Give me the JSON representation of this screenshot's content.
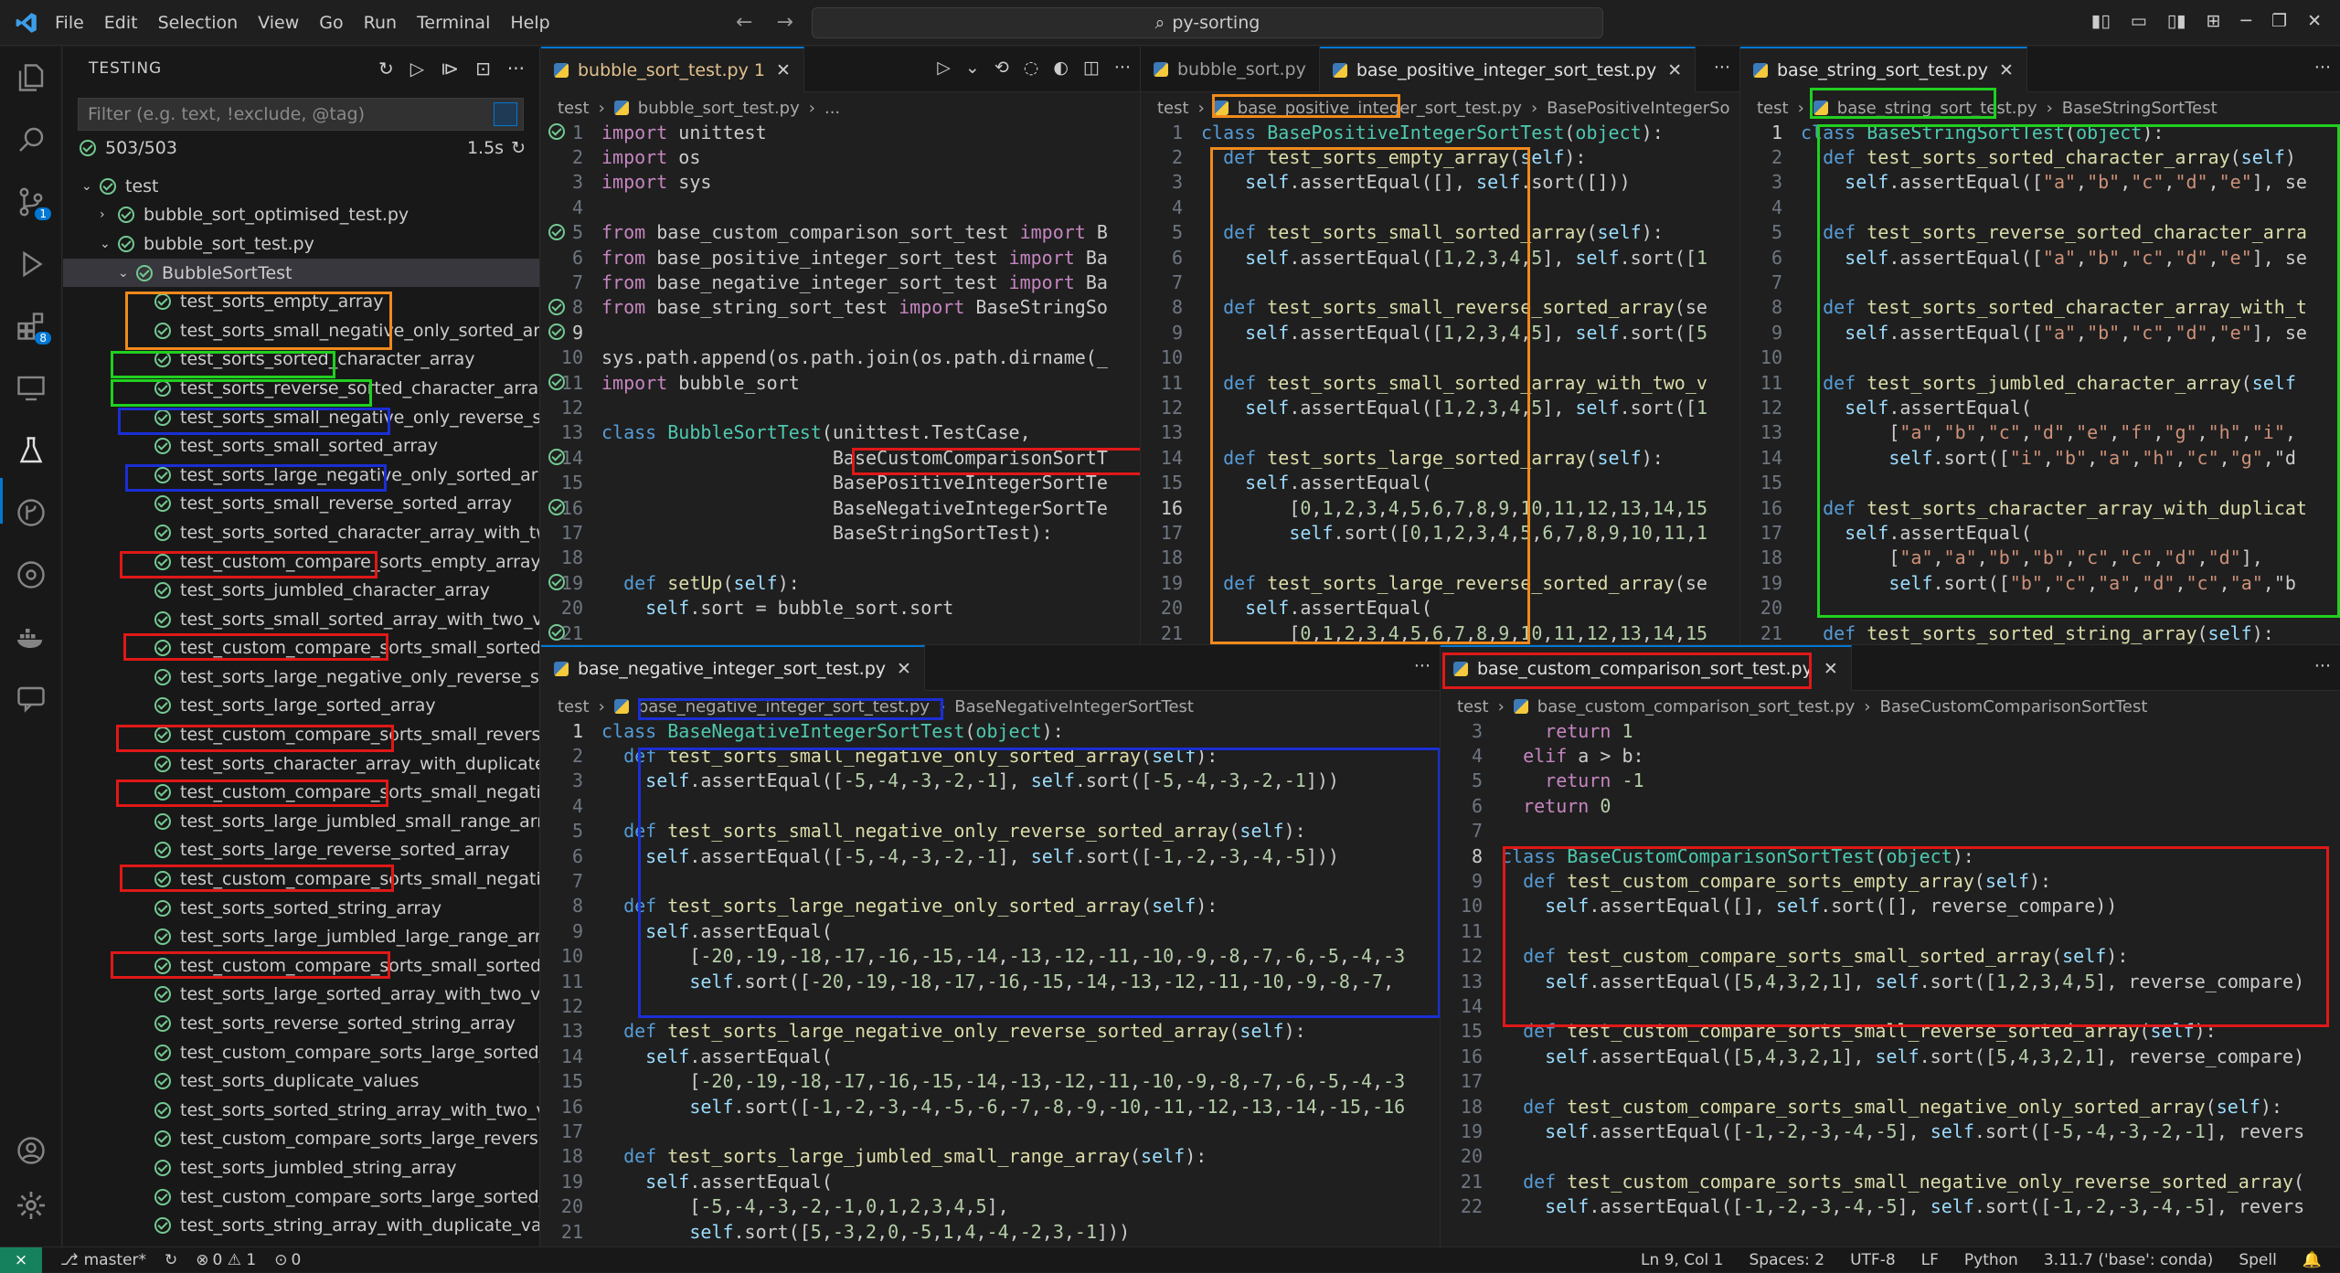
{
  "menu": [
    "File",
    "Edit",
    "Selection",
    "View",
    "Go",
    "Run",
    "Terminal",
    "Help"
  ],
  "command_center": "py-sorting",
  "sidebar": {
    "title": "TESTING",
    "filter_placeholder": "Filter (e.g. text, !exclude, @tag)",
    "summary": "503/503",
    "duration": "1.5s",
    "tree": [
      {
        "label": "test",
        "indent": 0,
        "chev": "v"
      },
      {
        "label": "bubble_sort_optimised_test.py",
        "indent": 1,
        "chev": ">"
      },
      {
        "label": "bubble_sort_test.py",
        "indent": 1,
        "chev": "v"
      },
      {
        "label": "BubbleSortTest",
        "indent": 2,
        "chev": "v"
      },
      {
        "label": "test_sorts_empty_array",
        "indent": 3
      },
      {
        "label": "test_sorts_small_negative_only_sorted_array",
        "indent": 3
      },
      {
        "label": "test_sorts_sorted_character_array",
        "indent": 3
      },
      {
        "label": "test_sorts_reverse_sorted_character_array",
        "indent": 3
      },
      {
        "label": "test_sorts_small_negative_only_reverse_sorte...",
        "indent": 3
      },
      {
        "label": "test_sorts_small_sorted_array",
        "indent": 3
      },
      {
        "label": "test_sorts_large_negative_only_sorted_array",
        "indent": 3
      },
      {
        "label": "test_sorts_small_reverse_sorted_array",
        "indent": 3
      },
      {
        "label": "test_sorts_sorted_character_array_with_two_v...",
        "indent": 3
      },
      {
        "label": "test_custom_compare_sorts_empty_array",
        "indent": 3
      },
      {
        "label": "test_sorts_jumbled_character_array",
        "indent": 3
      },
      {
        "label": "test_sorts_small_sorted_array_with_two_valu...",
        "indent": 3
      },
      {
        "label": "test_custom_compare_sorts_small_sorted_arr...",
        "indent": 3
      },
      {
        "label": "test_sorts_large_negative_only_reverse_sorte...",
        "indent": 3
      },
      {
        "label": "test_sorts_large_sorted_array",
        "indent": 3
      },
      {
        "label": "test_custom_compare_sorts_small_reverse_so...",
        "indent": 3
      },
      {
        "label": "test_sorts_character_array_with_duplicate_val...",
        "indent": 3
      },
      {
        "label": "test_custom_compare_sorts_small_negative_...",
        "indent": 3
      },
      {
        "label": "test_sorts_large_jumbled_small_range_array",
        "indent": 3
      },
      {
        "label": "test_sorts_large_reverse_sorted_array",
        "indent": 3
      },
      {
        "label": "test_custom_compare_sorts_small_negative_...",
        "indent": 3
      },
      {
        "label": "test_sorts_sorted_string_array",
        "indent": 3
      },
      {
        "label": "test_sorts_large_jumbled_large_range_array",
        "indent": 3
      },
      {
        "label": "test_custom_compare_sorts_small_sorted_arr...",
        "indent": 3
      },
      {
        "label": "test_sorts_large_sorted_array_with_two_value...",
        "indent": 3
      },
      {
        "label": "test_sorts_reverse_sorted_string_array",
        "indent": 3
      },
      {
        "label": "test_custom_compare_sorts_large_sorted_arr...",
        "indent": 3
      },
      {
        "label": "test_sorts_duplicate_values",
        "indent": 3
      },
      {
        "label": "test_sorts_sorted_string_array_with_two_valu...",
        "indent": 3
      },
      {
        "label": "test_custom_compare_sorts_large_reverse_so...",
        "indent": 3
      },
      {
        "label": "test_sorts_jumbled_string_array",
        "indent": 3
      },
      {
        "label": "test_custom_compare_sorts_large_sorted_arr...",
        "indent": 3
      },
      {
        "label": "test_sorts_string_array_with_duplicate_values",
        "indent": 3
      }
    ]
  },
  "editor1": {
    "tab": "bubble_sort_test.py",
    "tab_badge": "1",
    "crumb": [
      "test",
      "bubble_sort_test.py",
      "..."
    ],
    "start": 1,
    "current": 9,
    "lines": [
      "import unittest",
      "import os",
      "import sys",
      "",
      "from base_custom_comparison_sort_test import B",
      "from base_positive_integer_sort_test import Ba",
      "from base_negative_integer_sort_test import Ba",
      "from base_string_sort_test import BaseStringSo",
      "",
      "sys.path.append(os.path.join(os.path.dirname(_",
      "import bubble_sort",
      "",
      "class BubbleSortTest(unittest.TestCase,",
      "                     BaseCustomComparisonSortT",
      "                     BasePositiveIntegerSortTe",
      "                     BaseNegativeIntegerSortTe",
      "                     BaseStringSortTest):",
      "",
      "  def setUp(self):",
      "    self.sort = bubble_sort.sort",
      "",
      "if __name__ == '__main__':"
    ]
  },
  "editor2": {
    "tabs": [
      "bubble_sort.py",
      "base_positive_integer_sort_test.py"
    ],
    "crumb": [
      "test",
      "base_positive_integer_sort_test.py",
      "BasePositiveIntegerSo"
    ],
    "start": 1,
    "current": 16,
    "lines": [
      "class BasePositiveIntegerSortTest(object):",
      "  def test_sorts_empty_array(self):",
      "    self.assertEqual([], self.sort([]))",
      "",
      "  def test_sorts_small_sorted_array(self):",
      "    self.assertEqual([1,2,3,4,5], self.sort([1",
      "",
      "  def test_sorts_small_reverse_sorted_array(se",
      "    self.assertEqual([1,2,3,4,5], self.sort([5",
      "",
      "  def test_sorts_small_sorted_array_with_two_v",
      "    self.assertEqual([1,2,3,4,5], self.sort([1",
      "",
      "  def test_sorts_large_sorted_array(self):",
      "    self.assertEqual(",
      "        [0,1,2,3,4,5,6,7,8,9,10,11,12,13,14,15",
      "        self.sort([0,1,2,3,4,5,6,7,8,9,10,11,1",
      "",
      "  def test_sorts_large_reverse_sorted_array(se",
      "    self.assertEqual(",
      "        [0,1,2,3,4,5,6,7,8,9,10,11,12,13,14,15"
    ]
  },
  "editor3": {
    "tab": "base_string_sort_test.py",
    "crumb": [
      "test",
      "base_string_sort_test.py",
      "BaseStringSortTest"
    ],
    "start": 1,
    "current": 1,
    "lines": [
      "class BaseStringSortTest(object):",
      "  def test_sorts_sorted_character_array(self)",
      "    self.assertEqual([\"a\",\"b\",\"c\",\"d\",\"e\"], se",
      "",
      "  def test_sorts_reverse_sorted_character_arra",
      "    self.assertEqual([\"a\",\"b\",\"c\",\"d\",\"e\"], se",
      "",
      "  def test_sorts_sorted_character_array_with_t",
      "    self.assertEqual([\"a\",\"b\",\"c\",\"d\",\"e\"], se",
      "",
      "  def test_sorts_jumbled_character_array(self",
      "    self.assertEqual(",
      "        [\"a\",\"b\",\"c\",\"d\",\"e\",\"f\",\"g\",\"h\",\"i\",",
      "        self.sort([\"i\",\"b\",\"a\",\"h\",\"c\",\"g\",\"d",
      "",
      "  def test_sorts_character_array_with_duplicat",
      "    self.assertEqual(",
      "        [\"a\",\"a\",\"b\",\"b\",\"c\",\"c\",\"d\",\"d\"],",
      "        self.sort([\"b\",\"c\",\"a\",\"d\",\"c\",\"a\",\"b",
      "",
      "  def test_sorts_sorted_string_array(self):"
    ]
  },
  "editor4": {
    "tab": "base_negative_integer_sort_test.py",
    "crumb": [
      "test",
      "base_negative_integer_sort_test.py",
      "BaseNegativeIntegerSortTest"
    ],
    "start": 1,
    "current": 1,
    "lines": [
      "class BaseNegativeIntegerSortTest(object):",
      "  def test_sorts_small_negative_only_sorted_array(self):",
      "    self.assertEqual([-5,-4,-3,-2,-1], self.sort([-5,-4,-3,-2,-1]))",
      "",
      "  def test_sorts_small_negative_only_reverse_sorted_array(self):",
      "    self.assertEqual([-5,-4,-3,-2,-1], self.sort([-1,-2,-3,-4,-5]))",
      "",
      "  def test_sorts_large_negative_only_sorted_array(self):",
      "    self.assertEqual(",
      "        [-20,-19,-18,-17,-16,-15,-14,-13,-12,-11,-10,-9,-8,-7,-6,-5,-4,-3",
      "        self.sort([-20,-19,-18,-17,-16,-15,-14,-13,-12,-11,-10,-9,-8,-7,",
      "",
      "  def test_sorts_large_negative_only_reverse_sorted_array(self):",
      "    self.assertEqual(",
      "        [-20,-19,-18,-17,-16,-15,-14,-13,-12,-11,-10,-9,-8,-7,-6,-5,-4,-3",
      "        self.sort([-1,-2,-3,-4,-5,-6,-7,-8,-9,-10,-11,-12,-13,-14,-15,-16",
      "",
      "  def test_sorts_large_jumbled_small_range_array(self):",
      "    self.assertEqual(",
      "        [-5,-4,-3,-2,-1,0,1,2,3,4,5],",
      "        self.sort([5,-3,2,0,-5,1,4,-4,-2,3,-1]))"
    ]
  },
  "editor5": {
    "tab": "base_custom_comparison_sort_test.py",
    "crumb": [
      "test",
      "base_custom_comparison_sort_test.py",
      "BaseCustomComparisonSortTest"
    ],
    "start": 3,
    "current": 8,
    "lines": [
      "    return 1",
      "  elif a > b:",
      "    return -1",
      "  return 0",
      "",
      "class BaseCustomComparisonSortTest(object):",
      "  def test_custom_compare_sorts_empty_array(self):",
      "    self.assertEqual([], self.sort([], reverse_compare))",
      "",
      "  def test_custom_compare_sorts_small_sorted_array(self):",
      "    self.assertEqual([5,4,3,2,1], self.sort([1,2,3,4,5], reverse_compare)",
      "",
      "  def test_custom_compare_sorts_small_reverse_sorted_array(self):",
      "    self.assertEqual([5,4,3,2,1], self.sort([5,4,3,2,1], reverse_compare)",
      "",
      "  def test_custom_compare_sorts_small_negative_only_sorted_array(self):",
      "    self.assertEqual([-1,-2,-3,-4,-5], self.sort([-5,-4,-3,-2,-1], revers",
      "",
      "  def test_custom_compare_sorts_small_negative_only_reverse_sorted_array(",
      "    self.assertEqual([-1,-2,-3,-4,-5], self.sort([-1,-2,-3,-4,-5], revers"
    ]
  },
  "statusbar": {
    "branch": "master*",
    "problems": "0 ⚠ 1",
    "ports": "0",
    "position": "Ln 9, Col 1",
    "spaces": "Spaces: 2",
    "encoding": "UTF-8",
    "eol": "LF",
    "language": "Python",
    "interpreter": "3.11.7 ('base': conda)",
    "spell": "Spell"
  },
  "colors": {
    "orange": "#f08a1c",
    "green": "#20d020",
    "blue": "#1a2fd6",
    "red": "#e01818",
    "accent": "#0078d4",
    "pass": "#73c991"
  }
}
